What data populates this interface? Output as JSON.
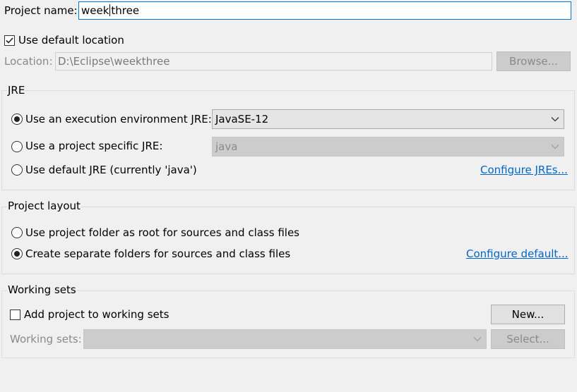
{
  "project": {
    "name_label": "Project name:",
    "name_value_before_caret": "week",
    "name_value_after_caret": "three",
    "use_default_location_label": "Use default location",
    "use_default_location_checked": true,
    "location_label": "Location:",
    "location_value": "D:\\Eclipse\\weekthree",
    "browse_label": "Browse..."
  },
  "jre": {
    "group_label": "JRE",
    "option_exec_env_label": "Use an execution environment JRE:",
    "exec_env_value": "JavaSE-12",
    "option_project_specific_label": "Use a project specific JRE:",
    "project_specific_value": "java",
    "option_default_label": "Use default JRE (currently 'java')",
    "configure_link": "Configure JREs...",
    "selected": "exec_env"
  },
  "layout": {
    "group_label": "Project layout",
    "option_root_label": "Use project folder as root for sources and class files",
    "option_separate_label": "Create separate folders for sources and class files",
    "configure_link": "Configure default...",
    "selected": "separate"
  },
  "working_sets": {
    "group_label": "Working sets",
    "add_label": "Add project to working sets",
    "add_checked": false,
    "new_label": "New...",
    "sets_label": "Working sets:",
    "sets_value": "",
    "select_label": "Select..."
  },
  "icons": {
    "checkmark": "checkmark-icon",
    "dropdown": "chevron-down-icon"
  }
}
